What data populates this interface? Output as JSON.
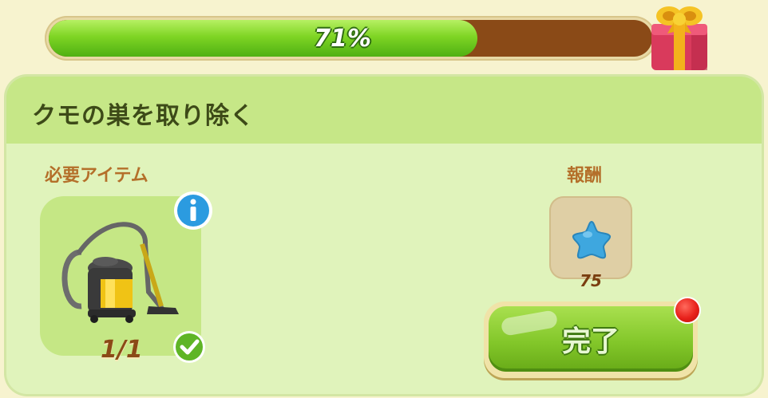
{
  "progress": {
    "percent": 71,
    "label": "71%",
    "reward_icon": "gift-box-icon"
  },
  "task": {
    "title": "クモの巣を取り除く"
  },
  "required": {
    "label": "必要アイテム",
    "item_icon": "vacuum-cleaner-icon",
    "count": "1/1",
    "info_icon": "info-icon",
    "status_icon": "checkmark-icon"
  },
  "reward": {
    "label": "報酬",
    "icon": "blue-star-icon",
    "value": "75"
  },
  "actions": {
    "complete_label": "完了",
    "notification_icon": "red-dot-icon"
  },
  "colors": {
    "progress_fill": "#7fd524",
    "progress_track": "#8a4a17",
    "panel": "#e0f3bb",
    "header": "#c6e787",
    "label": "#b46f2a",
    "button": "#83c72a"
  }
}
